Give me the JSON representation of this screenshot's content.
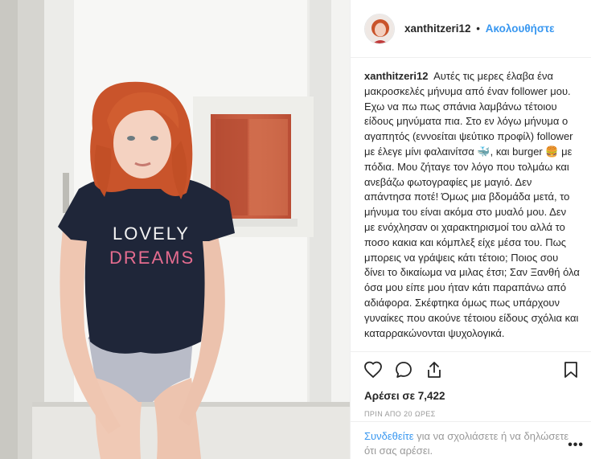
{
  "post": {
    "tshirt_line1": "LOVELY",
    "tshirt_line2": "DREAMS"
  },
  "header": {
    "username": "xanthitzeri12",
    "separator": "•",
    "follow_label": "Ακολουθήστε"
  },
  "caption": {
    "username": "xanthitzeri12",
    "text": "Αυτές τις μερες έλαβα ένα μακροσκελές μήνυμα από έναν follower μου. Εχω να πω πως σπάνια λαμβάνω τέτοιου είδους μηνύματα πια. Στο εν λόγω μήνυμα ο αγαπητός (εννοείται ψεύτικο προφίλ) follower με έλεγε μίνι φαλαινίτσα 🐳, και burger 🍔 με πόδια. Μου ζήταγε τον λόγο που τολμάω και ανεβάζω φωτογραφίες με μαγιό. Δεν απάντησα ποτέ! Όμως μια βδομάδα μετά, το μήνυμα του είναι ακόμα στο μυαλό μου. Δεν με ενόχλησαν οι χαρακτηρισμοί του αλλά το ποσο κακια και κόμπλεξ είχε μέσα του. Πως μπορεις να γράψεις κάτι τέτοιο; Ποιος σου δίνει το δικαίωμα να μιλας έτσι; Σαν Ξανθή όλα όσα μου είπε μου ήταν κάτι παραπάνω από αδιάφορα. Σκέφτηκα όμως πως υπάρχουν γυναίκες που ακούνε τέτοιου είδους σχόλια και καταρρακώνονται ψυχολογικά."
  },
  "actions": {
    "icons": [
      "heart-icon",
      "comment-icon",
      "share-icon",
      "bookmark-icon"
    ]
  },
  "likes": {
    "label": "Αρέσει σε 7,422"
  },
  "timestamp": "ΠΡΙΝ ΑΠΟ 20 ΩΡΕΣ",
  "login_bar": {
    "link_text": "Συνδεθείτε",
    "rest_text": " για να σχολιάσετε ή να δηλώσετε ότι σας αρέσει.",
    "more_label": "•••"
  },
  "colors": {
    "link_blue": "#3897f0",
    "text": "#262626",
    "muted": "#999999",
    "border": "#efefef"
  }
}
